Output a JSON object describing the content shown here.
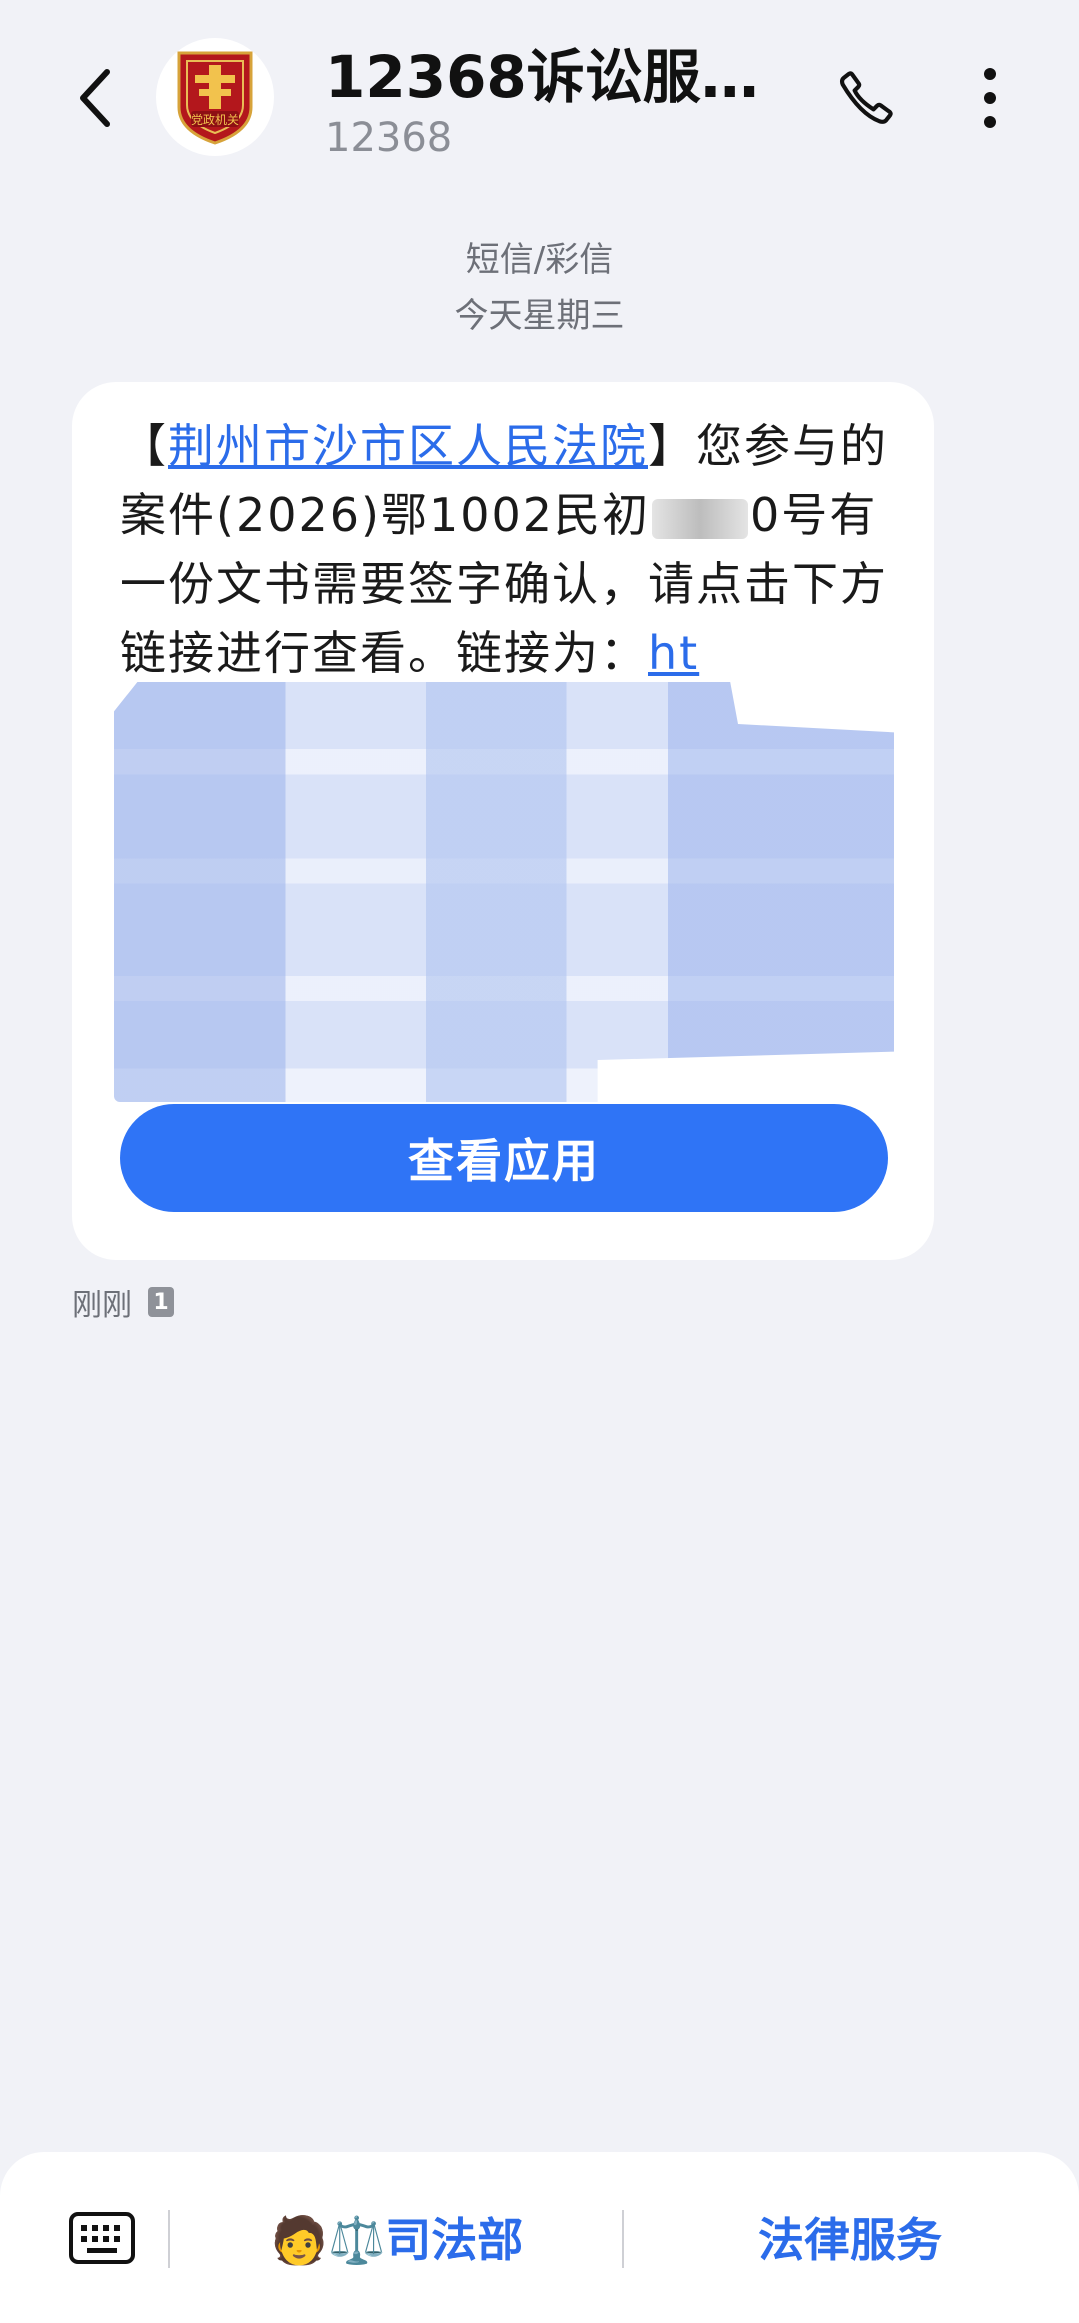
{
  "header": {
    "title": "12368诉讼服务…",
    "subtitle": "12368",
    "avatar_icon": "party-government-emblem-icon",
    "avatar_badge_text": "党政机关"
  },
  "conversation": {
    "type_label": "短信/彩信",
    "date_label": "今天星期三"
  },
  "message": {
    "bracket_open": "【",
    "sender_link": "荆州市沙市区人民法院",
    "text_part1": "】您参与的案件(2026)鄂1002民初",
    "case_suffix": "0号",
    "text_part2": "有一份文书需要签字确认，请点击下方链接进行查看。链接为：",
    "link_start": "ht",
    "button_label": "查看应用",
    "timestamp": "刚刚",
    "sim_badge": "1"
  },
  "bottom_bar": {
    "keyboard_icon": "keyboard-icon",
    "menu_1_label": "🧑⚖️司法部",
    "menu_2_label": "法律服务"
  },
  "colors": {
    "accent": "#2f74f6",
    "link": "#2b6cea",
    "background": "#f1f2f7"
  }
}
